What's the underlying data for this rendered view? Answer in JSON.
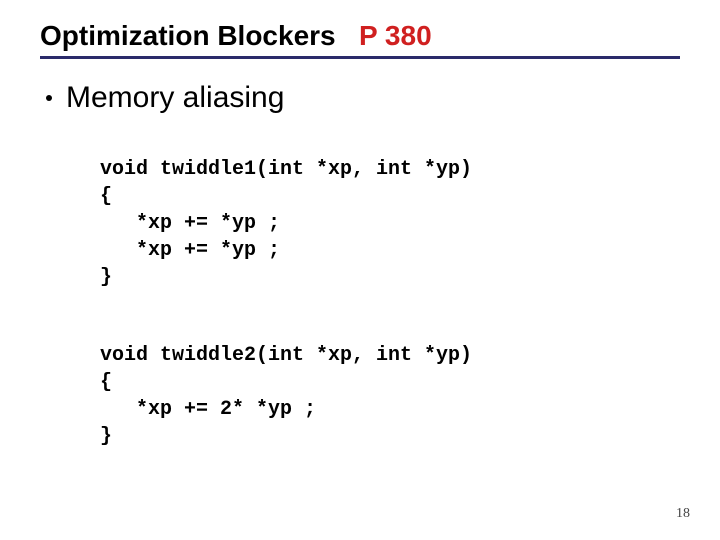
{
  "title": {
    "main": "Optimization Blockers",
    "page_ref": "P 380"
  },
  "bullet": "Memory aliasing",
  "code1": {
    "l1": "void twiddle1(int *xp, int *yp)",
    "l2": "{",
    "l3": "   *xp += *yp ;",
    "l4": "   *xp += *yp ;",
    "l5": "}"
  },
  "code2": {
    "l1": "void twiddle2(int *xp, int *yp)",
    "l2": "{",
    "l3": "   *xp += 2* *yp ;",
    "l4": "}"
  },
  "page_number": "18"
}
